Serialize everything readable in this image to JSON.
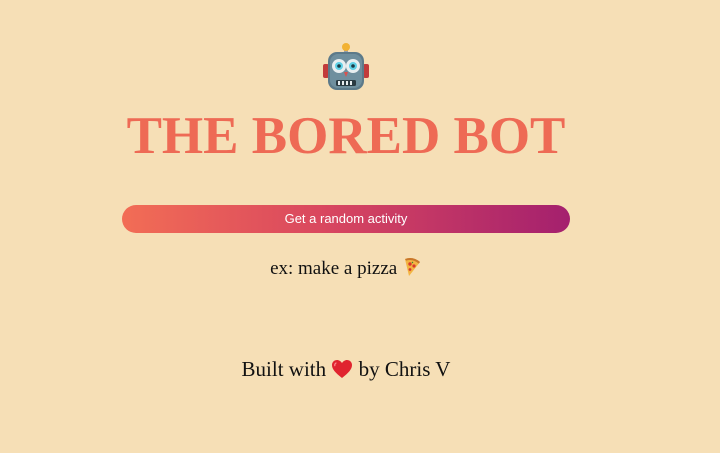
{
  "header": {
    "icon": "robot-icon",
    "title": "THE BORED BOT"
  },
  "main": {
    "button_label": "Get a random activity",
    "activity_text": "ex: make a pizza",
    "activity_icon": "pizza-icon"
  },
  "footer": {
    "prefix": "Built with",
    "heart_icon": "heart-icon",
    "suffix": "by Chris V"
  },
  "colors": {
    "background": "#f6dfb6",
    "title": "#ee6a55",
    "button_gradient_start": "#f26d55",
    "button_gradient_end": "#a4206e"
  }
}
